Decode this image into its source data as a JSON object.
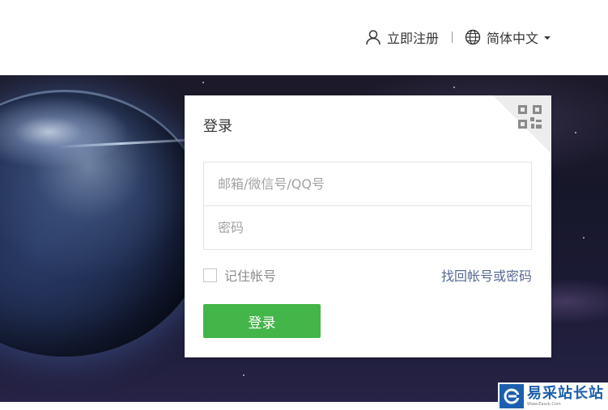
{
  "header": {
    "register_label": "立即注册",
    "language_label": "简体中文",
    "user_icon": "user-icon",
    "globe_icon": "globe-icon"
  },
  "login": {
    "title": "登录",
    "qr_icon": "qr-code-icon",
    "account_placeholder": "邮箱/微信号/QQ号",
    "account_value": "",
    "password_placeholder": "密码",
    "password_value": "",
    "remember_label": "记住帐号",
    "remember_checked": false,
    "forgot_label": "找回帐号或密码",
    "submit_label": "登录"
  },
  "colors": {
    "primary_green": "#44b549",
    "link_blue": "#576b95",
    "watermark_blue": "#1c5fae"
  },
  "watermark": {
    "name": "易采站长站",
    "url": "Www.Easck.Com"
  }
}
